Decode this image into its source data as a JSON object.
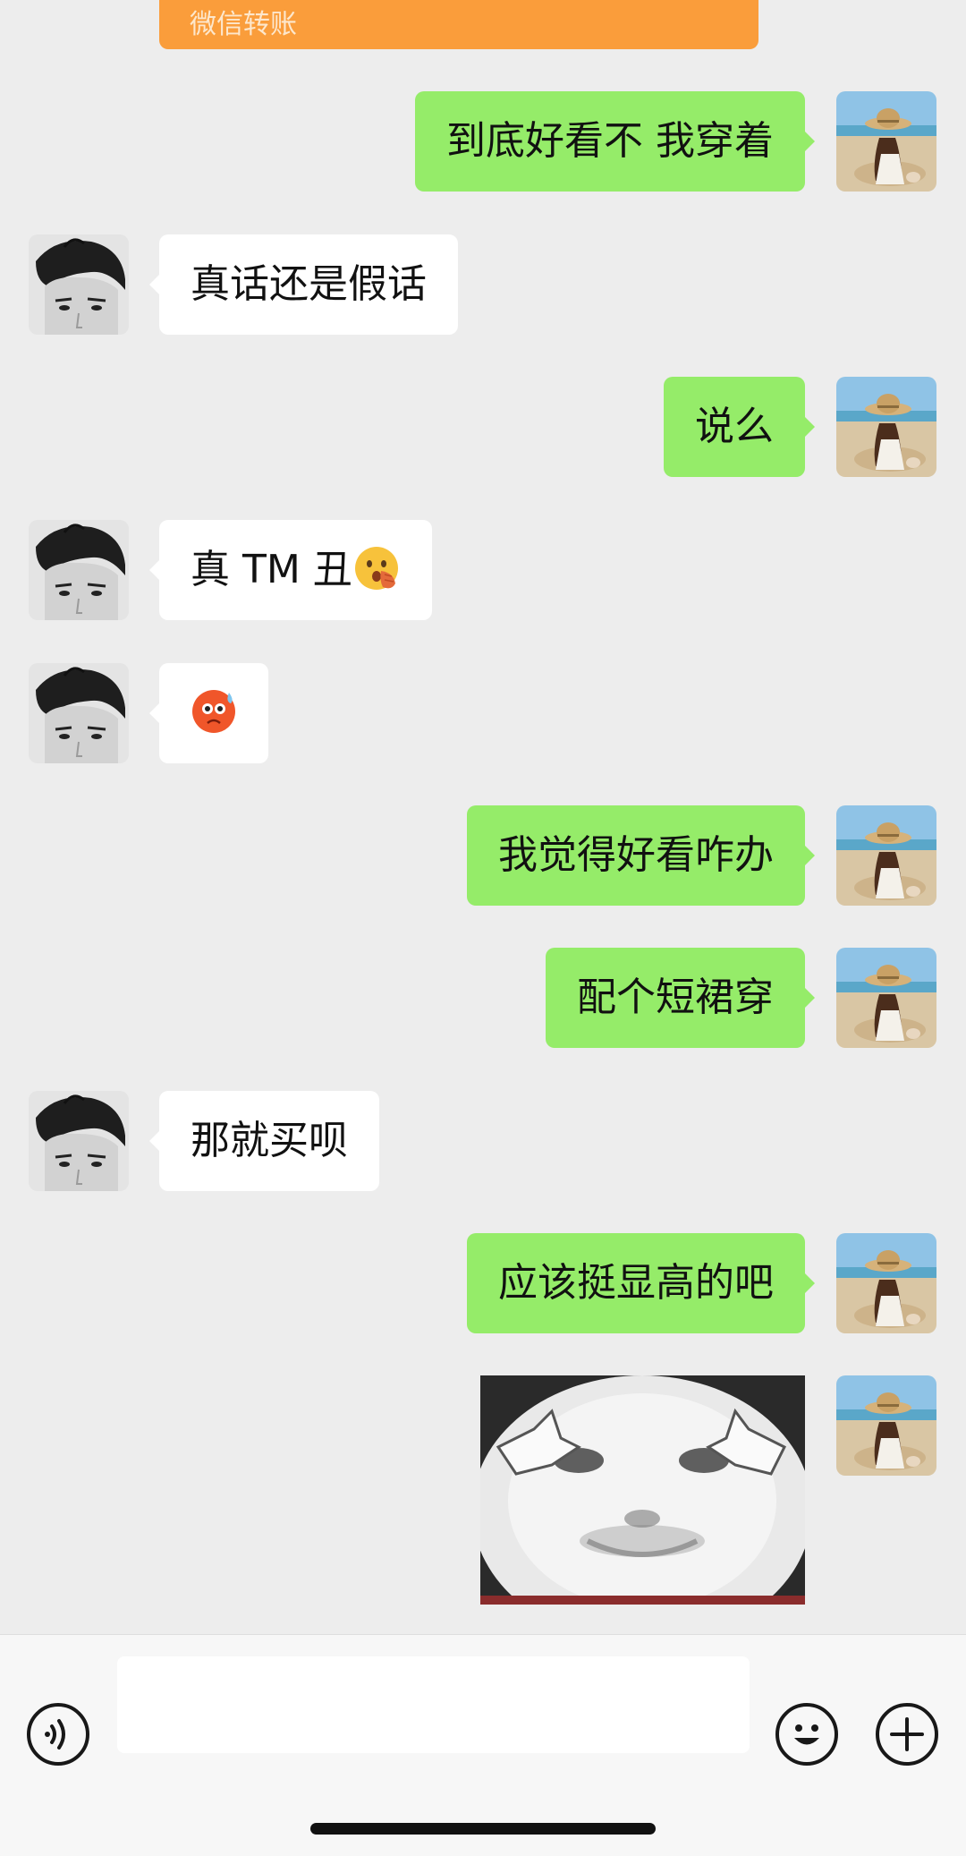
{
  "transfer": {
    "label": "微信转账"
  },
  "messages": [
    {
      "sender": "me",
      "text": "到底好看不 我穿着"
    },
    {
      "sender": "them",
      "text": "真话还是假话"
    },
    {
      "sender": "me",
      "text": "说么"
    },
    {
      "sender": "them",
      "text": "真 TM 丑",
      "emoji": "shushing-face-emoji"
    },
    {
      "sender": "them",
      "text": "",
      "emoji": "cold-face-emoji"
    },
    {
      "sender": "me",
      "text": "我觉得好看咋办"
    },
    {
      "sender": "me",
      "text": "配个短裙穿"
    },
    {
      "sender": "them",
      "text": "那就买呗"
    },
    {
      "sender": "me",
      "text": "应该挺显高的吧"
    },
    {
      "sender": "me",
      "type": "sticker",
      "sticker": "panda-face-sticker"
    }
  ],
  "input_bar": {
    "placeholder": "",
    "value": "",
    "icons": [
      "voice-icon",
      "emoji-face-icon",
      "plus-icon"
    ]
  },
  "colors": {
    "background": "#ededed",
    "my_bubble": "#95ec69",
    "their_bubble": "#ffffff",
    "transfer_card": "#fa9d3b"
  }
}
